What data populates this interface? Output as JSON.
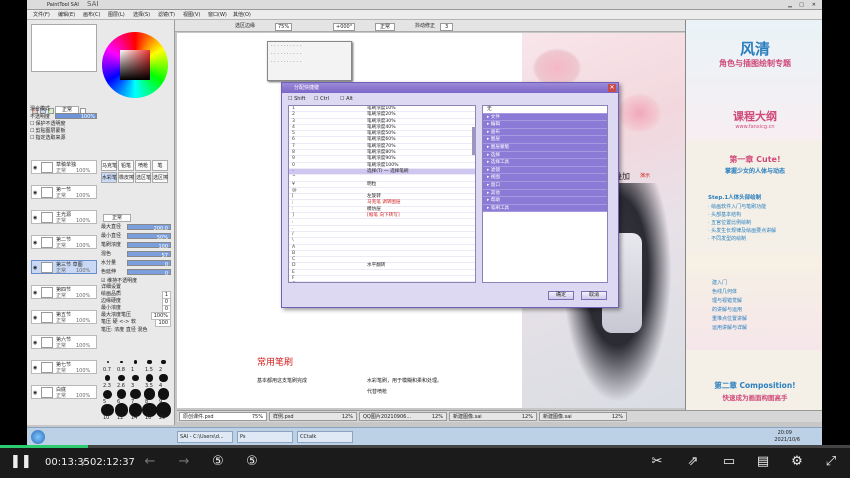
{
  "app": {
    "title": "SAI",
    "window_title": "PaintTool SAI"
  },
  "menu": [
    "文件(F)",
    "编辑(E)",
    "画布(C)",
    "图层(L)",
    "选择(S)",
    "滤镜(T)",
    "视图(V)",
    "窗口(W)",
    "其他(O)"
  ],
  "toolbar": {
    "zoom": "75%",
    "angle": "+000°",
    "mode": "正常",
    "stab_label": "抖动修正",
    "stab_value": "3",
    "stab_checkbox": "选区边缘"
  },
  "left_panel": {
    "blend_label": "混合模式",
    "blend_value": "正常",
    "opacity_label": "不透明度",
    "opacity_value": "100%",
    "checks": [
      "保护不透明度",
      "剪贴图层蒙板",
      "指定选取来源"
    ],
    "tool_labels": [
      "马克笔",
      "铅笔",
      "喷枪",
      "笔",
      "水彩笔",
      "橡皮擦",
      "选区笔",
      "选区擦"
    ],
    "brush_shape": "正常",
    "size_label": "最大直径",
    "size_value": "200.0",
    "minsize_label": "最小直径",
    "minsize_value": "50%",
    "density_label": "笔刷浓度",
    "density_value": "100",
    "mixing_label": "混色",
    "mixing_value": "57",
    "water_label": "水分量",
    "water_value": "0",
    "persist_label": "色延伸",
    "persist_value": "0",
    "keep_opacity": "维持不透明度",
    "detail_label": "详细设置",
    "quality_label": "绘画品质",
    "quality_value": "1",
    "edge_label": "边缘硬度",
    "edge_value": "0",
    "mindensity_label": "最小浓度",
    "mindensity_value": "0",
    "maxpressure_label": "最大浓度笔压",
    "maxpressure_value": "100%",
    "pressure_label": "笔压 硬 <-> 软",
    "pressure_value": "100",
    "pressure_checks": "笔压: 浓度 直径 混色",
    "brush_sizes": [
      "0.7",
      "0.8",
      "1",
      "1.5",
      "2",
      "2.3",
      "2.6",
      "3",
      "3.5",
      "4",
      "5",
      "6",
      "7",
      "8",
      "9",
      "10",
      "12",
      "14",
      "16",
      "20"
    ],
    "layers": [
      {
        "name": "草稿单独",
        "mode": "正常",
        "opacity": "100%"
      },
      {
        "name": "第一节",
        "mode": "正常",
        "opacity": "100%"
      },
      {
        "name": "主光源",
        "mode": "正常",
        "opacity": "100%"
      },
      {
        "name": "第二节",
        "mode": "正常",
        "opacity": "100%"
      },
      {
        "name": "第三节 草图",
        "mode": "正常",
        "opacity": "100%"
      },
      {
        "name": "第四节",
        "mode": "正常",
        "opacity": "100%"
      },
      {
        "name": "第五节",
        "mode": "正常",
        "opacity": "100%"
      },
      {
        "name": "第六节",
        "mode": "正常",
        "opacity": "100%"
      },
      {
        "name": "第七节",
        "mode": "正常",
        "opacity": "100%"
      },
      {
        "name": "白底",
        "mode": "正常",
        "opacity": "100%"
      }
    ]
  },
  "doc": {
    "heading": "常用笔刷",
    "line1": "基本都用这支笔刷完成",
    "line2": "水彩笔刷，用于模糊和柔和处理。",
    "line3": "代替喷枪",
    "overlay_label": "叠加",
    "overlay_note": "演示"
  },
  "dialog": {
    "title": "分配快捷键",
    "modifiers": [
      "Shift",
      "Ctrl",
      "Alt"
    ],
    "keys": [
      "1",
      "2",
      "3",
      "4",
      "5",
      "6",
      "7",
      "8",
      "9",
      "0",
      "-",
      "^",
      "¥",
      "@",
      "[",
      ";",
      ":",
      "]",
      ",",
      ".",
      "/",
      "\\",
      "A",
      "B",
      "C",
      "D",
      "E",
      "F",
      "G"
    ],
    "values": [
      "笔刷浓度10%",
      "笔刷浓度20%",
      "笔刷浓度30%",
      "笔刷浓度40%",
      "笔刷浓度50%",
      "笔刷浓度60%",
      "笔刷浓度70%",
      "笔刷浓度80%",
      "笔刷浓度90%",
      "笔刷浓度100%",
      "选择(T) 一 选择笔刷",
      "",
      "明粒",
      "",
      "左旋转",
      "马克笔 调转图层",
      "模仿层",
      "[缩笔 向下转写]",
      "",
      "",
      "",
      "",
      "",
      "",
      "",
      "水平翻转",
      "",
      "",
      ""
    ],
    "red_rows": [
      15,
      17
    ],
    "selected_row": 10,
    "commands": [
      "无",
      "文件",
      "编辑",
      "画布",
      "图层",
      "图层蒙版",
      "选择",
      "选择工具",
      "滤镜",
      "视图",
      "窗口",
      "其他",
      "帮助",
      "笔刷工具"
    ],
    "ok": "确定",
    "cancel": "取消"
  },
  "right_panel": {
    "title1": "风清",
    "title2": "角色与插图绘制专题",
    "subtitle": "课程大纲",
    "url": "www.fanxicg.cn",
    "chapter1": "第一章 Cute!",
    "chapter1_sub": "掌握少女的人体与动态",
    "step_title": "Step.1人体头部绘制",
    "steps": [
      "绘画软件入门与笔刷功能",
      "头部基本结构",
      "五官位置比例绘制",
      "头发生长规律及绘画要点讲解",
      "不同发型的绘制"
    ],
    "items2": [
      "建入门",
      "色线几何体",
      "理与视错觉解",
      "的讲解与运用",
      "重堆点位置讲解",
      "运用讲解与详解"
    ],
    "chapter2": "第二章 Composition!",
    "chapter2_sub": "快速成为画面构图高手"
  },
  "tabs": [
    {
      "name": "原创课件.psd",
      "zoom": "75%"
    },
    {
      "name": "样例.psd",
      "zoom": "12%"
    },
    {
      "name": "QQ图片20210906...",
      "zoom": "12%"
    },
    {
      "name": "新建图像.sai",
      "zoom": "12%"
    },
    {
      "name": "新建图像.sai",
      "zoom": "12%"
    }
  ],
  "taskbar": {
    "clock": "20:09",
    "date": "2021/10/6",
    "apps": [
      "SAI - C:\\Users\\d...",
      "Ps",
      "CCtalk"
    ]
  },
  "player": {
    "current": "00:13:35",
    "separator": "/",
    "total": "02:12:37",
    "progress": 0.103
  }
}
